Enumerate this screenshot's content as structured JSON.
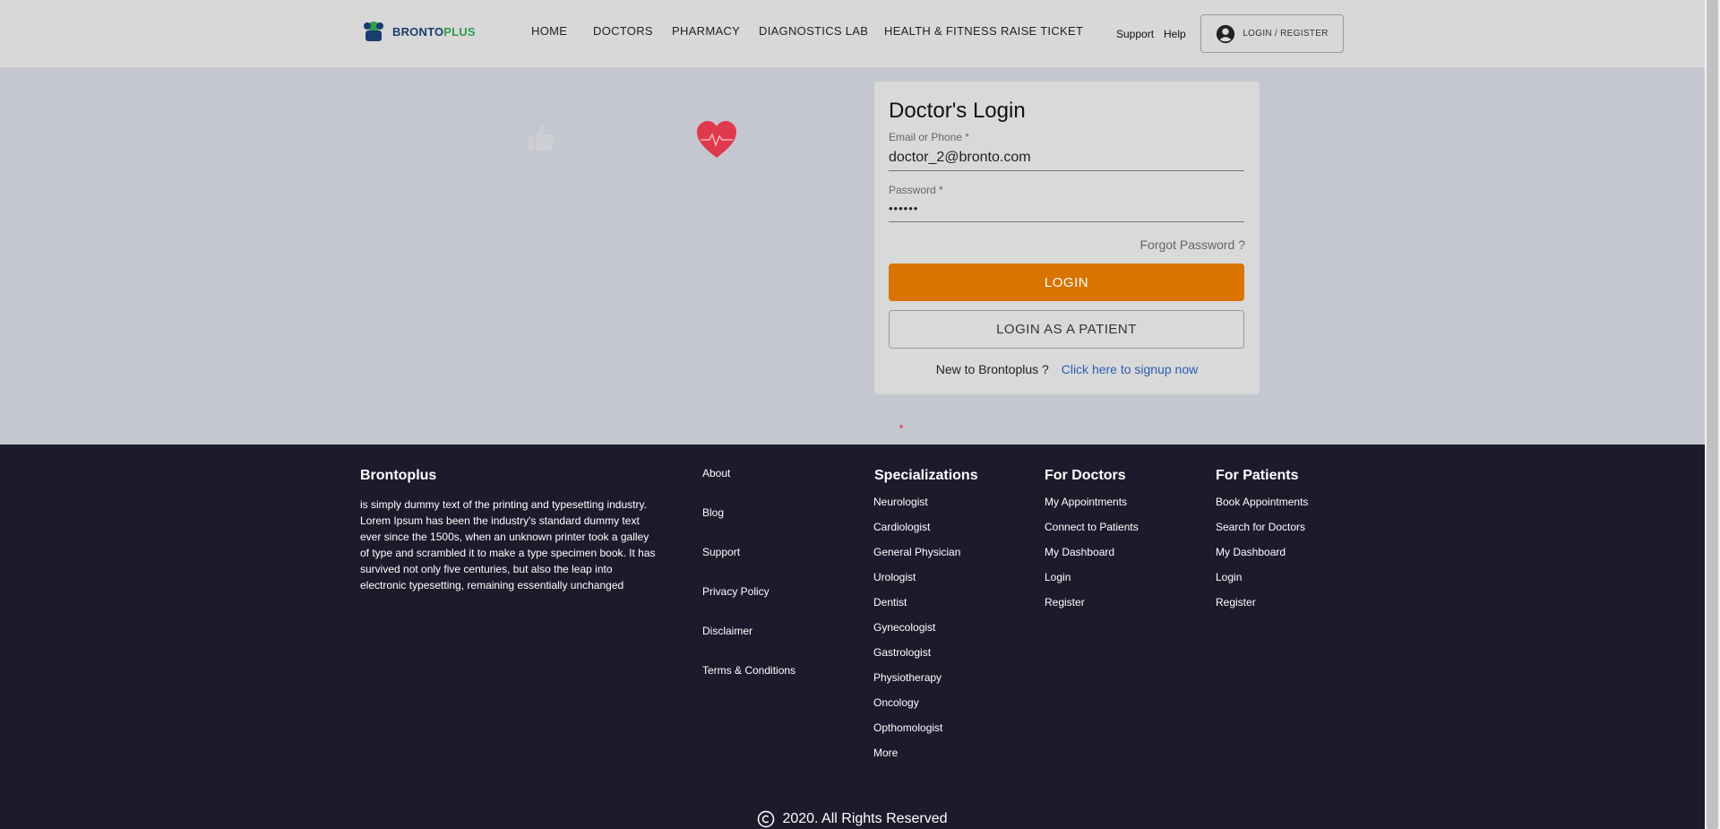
{
  "header": {
    "logo": {
      "part_a": "BRONTO",
      "part_b": "PLUS"
    },
    "nav": [
      {
        "label": "HOME"
      },
      {
        "label": "DOCTORS"
      },
      {
        "label": "PHARMACY"
      },
      {
        "label": "DIAGNOSTICS LAB"
      },
      {
        "label": "HEALTH & FITNESS"
      },
      {
        "label": "RAISE TICKET"
      }
    ],
    "support": "Support",
    "help": "Help",
    "login_register": "LOGIN / REGISTER",
    "login_icon": "account-circle-icon"
  },
  "login_card": {
    "title": "Doctor's Login",
    "email_label": "Email or Phone *",
    "email_value": "doctor_2@bronto.com",
    "password_label": "Password *",
    "password_value": "••••••",
    "forgot": "Forgot Password ?",
    "login_button": "LOGIN",
    "patient_button": "LOGIN AS A PATIENT",
    "new_text": "New to Brontoplus ?",
    "signup_link": "Click here to signup now"
  },
  "colors": {
    "accent": "#d97400",
    "footer_bg": "#1c1b2c",
    "hero_bg": "#c4c7d0",
    "link": "#2a5db0"
  },
  "footer": {
    "brand_title": "Brontoplus",
    "brand_text": "is simply dummy text of the printing and typesetting industry. Lorem Ipsum has been the industry's standard dummy text ever since the 1500s, when an unknown printer took a galley of type and scrambled it to make a type specimen book. It has survived not only five centuries, but also the leap into electronic typesetting, remaining essentially unchanged",
    "links": [
      "About",
      "Blog",
      "Support",
      "Privacy Policy",
      "Disclaimer",
      "Terms & Conditions"
    ],
    "specializations_title": "Specializations",
    "specializations": [
      "Neurologist",
      "Cardiologist",
      "General Physician",
      "Urologist",
      "Dentist",
      "Gynecologist",
      "Gastrologist",
      "Physiotherapy",
      "Oncology",
      "Opthomologist",
      "More"
    ],
    "doctors_title": "For Doctors",
    "doctors_links": [
      "My Appointments",
      "Connect to Patients",
      "My Dashboard",
      "Login",
      "Register"
    ],
    "patients_title": "For Patients",
    "patients_links": [
      "Book Appointments",
      "Search for Doctors",
      "My Dashboard",
      "Login",
      "Register"
    ],
    "copyright": "2020. All Rights Reserved"
  }
}
